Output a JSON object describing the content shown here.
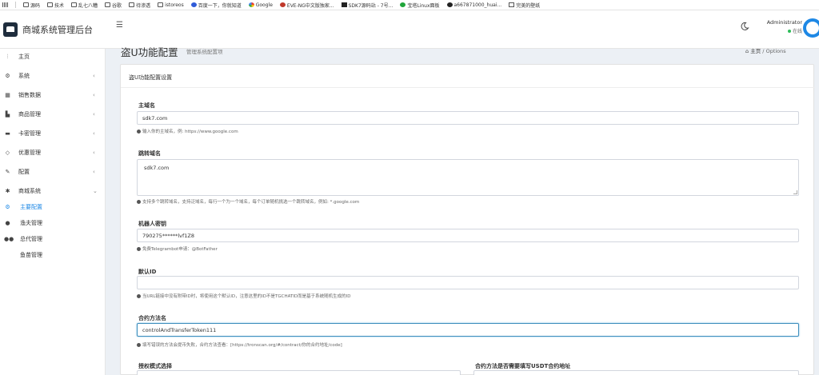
{
  "bookmarks": [
    {
      "label": "",
      "icon": "apps-icon"
    },
    {
      "label": "源码",
      "icon": "folder-icon"
    },
    {
      "label": "技术",
      "icon": "folder-icon"
    },
    {
      "label": "乱七八糟",
      "icon": "folder-icon"
    },
    {
      "label": "谷歌",
      "icon": "folder-icon"
    },
    {
      "label": "待渗透",
      "icon": "folder-icon"
    },
    {
      "label": "istoreos",
      "icon": "folder-icon"
    },
    {
      "label": "百度一下，你就知道",
      "icon": "baidu-icon"
    },
    {
      "label": "Google",
      "icon": "google-icon"
    },
    {
      "label": "EVE-NG中文版独家...",
      "icon": "eve-icon"
    },
    {
      "label": "SDK7源码站 - 7号...",
      "icon": "sdk7-icon"
    },
    {
      "label": "宝塔Linux面板",
      "icon": "baota-icon"
    },
    {
      "label": "a667871000_huai...",
      "icon": "github-icon"
    },
    {
      "label": "完美的壁纸",
      "icon": "wallpaper-icon"
    }
  ],
  "header": {
    "app_title": "商城系统管理后台",
    "user_name": "Administrator",
    "user_status": "在线"
  },
  "sidebar": {
    "items": [
      {
        "label": "主页",
        "icon": "dashboard-icon"
      },
      {
        "label": "系统",
        "icon": "gear-icon",
        "chevron": "‹"
      },
      {
        "label": "销售数据",
        "icon": "table-icon",
        "chevron": "‹"
      },
      {
        "label": "商品管理",
        "icon": "shop-icon",
        "chevron": "‹"
      },
      {
        "label": "卡密管理",
        "icon": "card-icon",
        "chevron": "‹"
      },
      {
        "label": "优惠管理",
        "icon": "diamond-icon",
        "chevron": "‹"
      },
      {
        "label": "配置",
        "icon": "wrench-icon",
        "chevron": "‹"
      },
      {
        "label": "商城系统",
        "icon": "cog-icon",
        "chevron": "⌄"
      },
      {
        "label": "主要配置",
        "icon": "cogs-icon"
      },
      {
        "label": "渔夫管理",
        "icon": "user-icon"
      },
      {
        "label": "总代管理",
        "icon": "users-icon"
      },
      {
        "label": "鱼苗管理",
        "icon": ""
      }
    ]
  },
  "page": {
    "title": "盗U功能配置",
    "subtitle": "管理系统配置项",
    "breadcrumb_home": "主页",
    "breadcrumb_sep": "/",
    "breadcrumb_current": "Options"
  },
  "panel": {
    "title": "盗U功能配置设置",
    "fields": {
      "main_domain": {
        "label": "主域名",
        "value": "sdk7.com",
        "help": "输入你的主域名，例: https://www.google.com"
      },
      "jump_domain": {
        "label": "跳转域名",
        "value": "sdk7.com",
        "help": "支持多个跳转域名，支持泛域名，每行一个为一个域名，每个订单随机挑选一个跳转域名，例如: *.google.com"
      },
      "bot_token": {
        "label": "机器人密钥",
        "value": "790275******lvf1Z8",
        "help": "免费Telegrambot申请：@BotFather"
      },
      "default_id": {
        "label": "默认ID",
        "value": "",
        "help": "当URL链接中没有附带ID时，将使用这个默认ID，注意这里的ID不是TGCHATID而是基于系统随机生成的ID"
      },
      "contract_method": {
        "label": "合约方法名",
        "value": "controlAndTransferToken111",
        "help": "填写错误的方法会提币失败，合约方法查看：[https://tronscan.org/#/contract/你的合约地址/code]"
      },
      "auth_mode": {
        "label": "授权模式选择"
      },
      "usdt_contract": {
        "label": "合约方法是否需要填写USDT合约地址"
      }
    }
  },
  "colors": {
    "accent": "#1e88e5",
    "online": "#2ebd59",
    "background": "#ecf0f5"
  }
}
